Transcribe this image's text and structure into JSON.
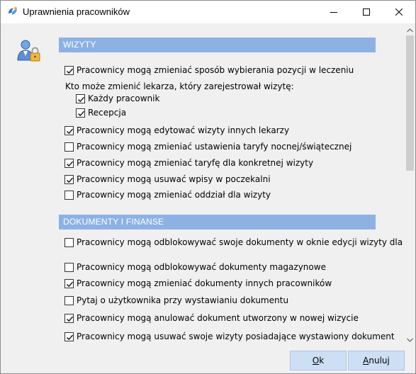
{
  "window": {
    "title": "Uprawnienia pracowników",
    "icons": {
      "app": "app-logo-icon",
      "minimize": "minimize-icon",
      "maximize": "maximize-icon",
      "close": "close-icon"
    }
  },
  "permissions_icon": "user-lock-icon",
  "sections": {
    "visits": {
      "header": "WIZYTY",
      "items": [
        {
          "label": "Pracownicy mogą zmieniać sposób wybierania pozycji w leczeniu",
          "checked": true
        },
        {
          "label": "Kto może zmienić lekarza, który zarejestrował wizytę:",
          "checked": null
        },
        {
          "label": "Każdy pracownik",
          "checked": true,
          "sub": true
        },
        {
          "label": "Recepcja",
          "checked": true,
          "sub": true
        },
        {
          "label": "Pracownicy mogą edytować wizyty innych lekarzy",
          "checked": true
        },
        {
          "label": "Pracownicy mogą zmieniać ustawienia taryfy nocnej/świątecznej",
          "checked": false
        },
        {
          "label": "Pracownicy mogą zmieniać taryfę dla konkretnej wizyty",
          "checked": true
        },
        {
          "label": "Pracownicy mogą usuwać wpisy w poczekalni",
          "checked": true
        },
        {
          "label": "Pracownicy mogą zmieniać oddział dla wizyty",
          "checked": false
        }
      ]
    },
    "documents": {
      "header": "DOKUMENTY I FINANSE",
      "items": [
        {
          "label": "Pracownicy mogą odblokowywać swoje dokumenty w oknie edycji wizyty dla",
          "checked": false
        },
        {
          "label": "Pracownicy mogą odblokowywać dokumenty magazynowe",
          "checked": false
        },
        {
          "label": "Pracownicy mogą zmieniać dokumenty innych pracowników",
          "checked": true
        },
        {
          "label": "Pytaj o użytkownika przy wystawianiu dokumentu",
          "checked": false
        },
        {
          "label": "Pracownicy mogą anulować dokument utworzony w nowej wizycie",
          "checked": true
        },
        {
          "label": "Pracownicy mogą usuwać swoje wizyty posiadające wystawiony dokument",
          "checked": true
        }
      ]
    }
  },
  "buttons": {
    "ok": {
      "mnemonic": "O",
      "rest": "k"
    },
    "cancel": {
      "mnemonic": "A",
      "rest": "nuluj"
    }
  },
  "colors": {
    "section_header": "#8eb1e4",
    "button_bg": "#ccdff4",
    "window_bg": "#f0f0f0"
  }
}
